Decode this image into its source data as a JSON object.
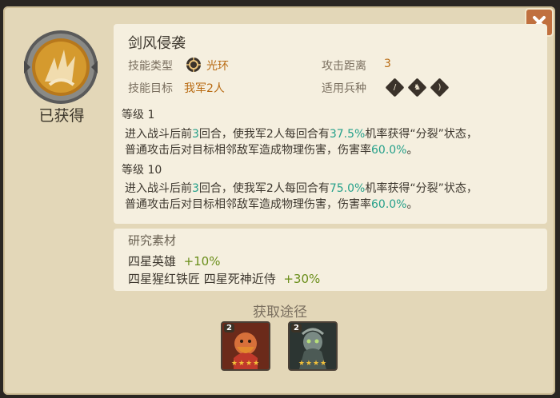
{
  "skill": {
    "name": "剑风侵袭",
    "status": "已获得",
    "type_label": "技能类型",
    "type_value": "光环",
    "range_label": "攻击距离",
    "range_value": "3",
    "target_label": "技能目标",
    "target_value": "我军2人",
    "troop_label": "适用兵种",
    "troop_icons": [
      "sword-icon",
      "horse-icon",
      "bow-icon"
    ]
  },
  "levels": [
    {
      "label": "等级 1",
      "desc_parts": [
        "进入战斗后前",
        "3",
        "回合，使我军2人每回合有",
        "37.5%",
        "机率获得“分裂”状态，",
        "普通攻击后对目标相邻敌军造成物理伤害，伤害率",
        "60.0%",
        "。"
      ]
    },
    {
      "label": "等级 10",
      "desc_parts": [
        "进入战斗后前",
        "3",
        "回合，使我军2人每回合有",
        "75.0%",
        "机率获得“分裂”状态，",
        "普通攻击后对目标相邻敌军造成物理伤害，伤害率",
        "60.0%",
        "。"
      ]
    }
  ],
  "materials": {
    "title": "研究素材",
    "rows": [
      {
        "names": "四星英雄",
        "bonus": "+10%"
      },
      {
        "names": "四星猩红铁匠 四星死神近侍",
        "bonus": "+30%"
      }
    ]
  },
  "sources": {
    "title": "获取途径",
    "heroes": [
      {
        "level": "2",
        "stars": "★★★★",
        "icon": "red-blacksmith-portrait"
      },
      {
        "level": "2",
        "stars": "★★★★",
        "icon": "death-servant-portrait"
      }
    ]
  },
  "colors": {
    "panel": "#e3d7b8",
    "card": "#f5efdf",
    "highlight": "#25a08a",
    "orange": "#b86a12",
    "green": "#6a8e1a",
    "close": "#c0703f"
  }
}
